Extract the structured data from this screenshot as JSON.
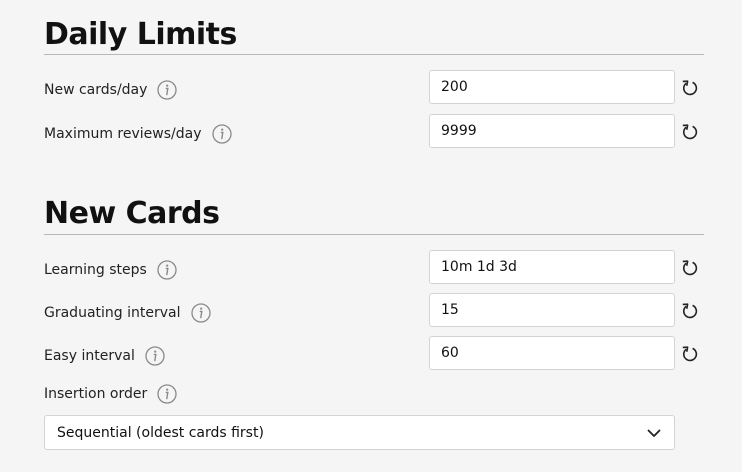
{
  "daily_limits": {
    "title": "Daily Limits",
    "rows": [
      {
        "label": "New cards/day",
        "value": "200",
        "icon": "info-icon",
        "reset_icon": "reset-icon"
      },
      {
        "label": "Maximum reviews/day",
        "value": "9999",
        "icon": "info-icon",
        "reset_icon": "reset-icon"
      }
    ]
  },
  "new_cards": {
    "title": "New Cards",
    "rows": [
      {
        "label": "Learning steps",
        "value": "10m 1d 3d",
        "icon": "info-icon",
        "reset_icon": "reset-icon"
      },
      {
        "label": "Graduating interval",
        "value": "15",
        "icon": "info-icon",
        "reset_icon": "reset-icon"
      },
      {
        "label": "Easy interval",
        "value": "60",
        "icon": "info-icon",
        "reset_icon": "reset-icon"
      }
    ],
    "insertion_order": {
      "label": "Insertion order",
      "selected": "Sequential (oldest cards first)",
      "icon": "chevron-down-icon"
    }
  },
  "colors": {
    "background": "#f5f5f5",
    "rule": "#b8b8b8",
    "field_border": "#d3d3d3",
    "icon": "#8a8a8a"
  }
}
